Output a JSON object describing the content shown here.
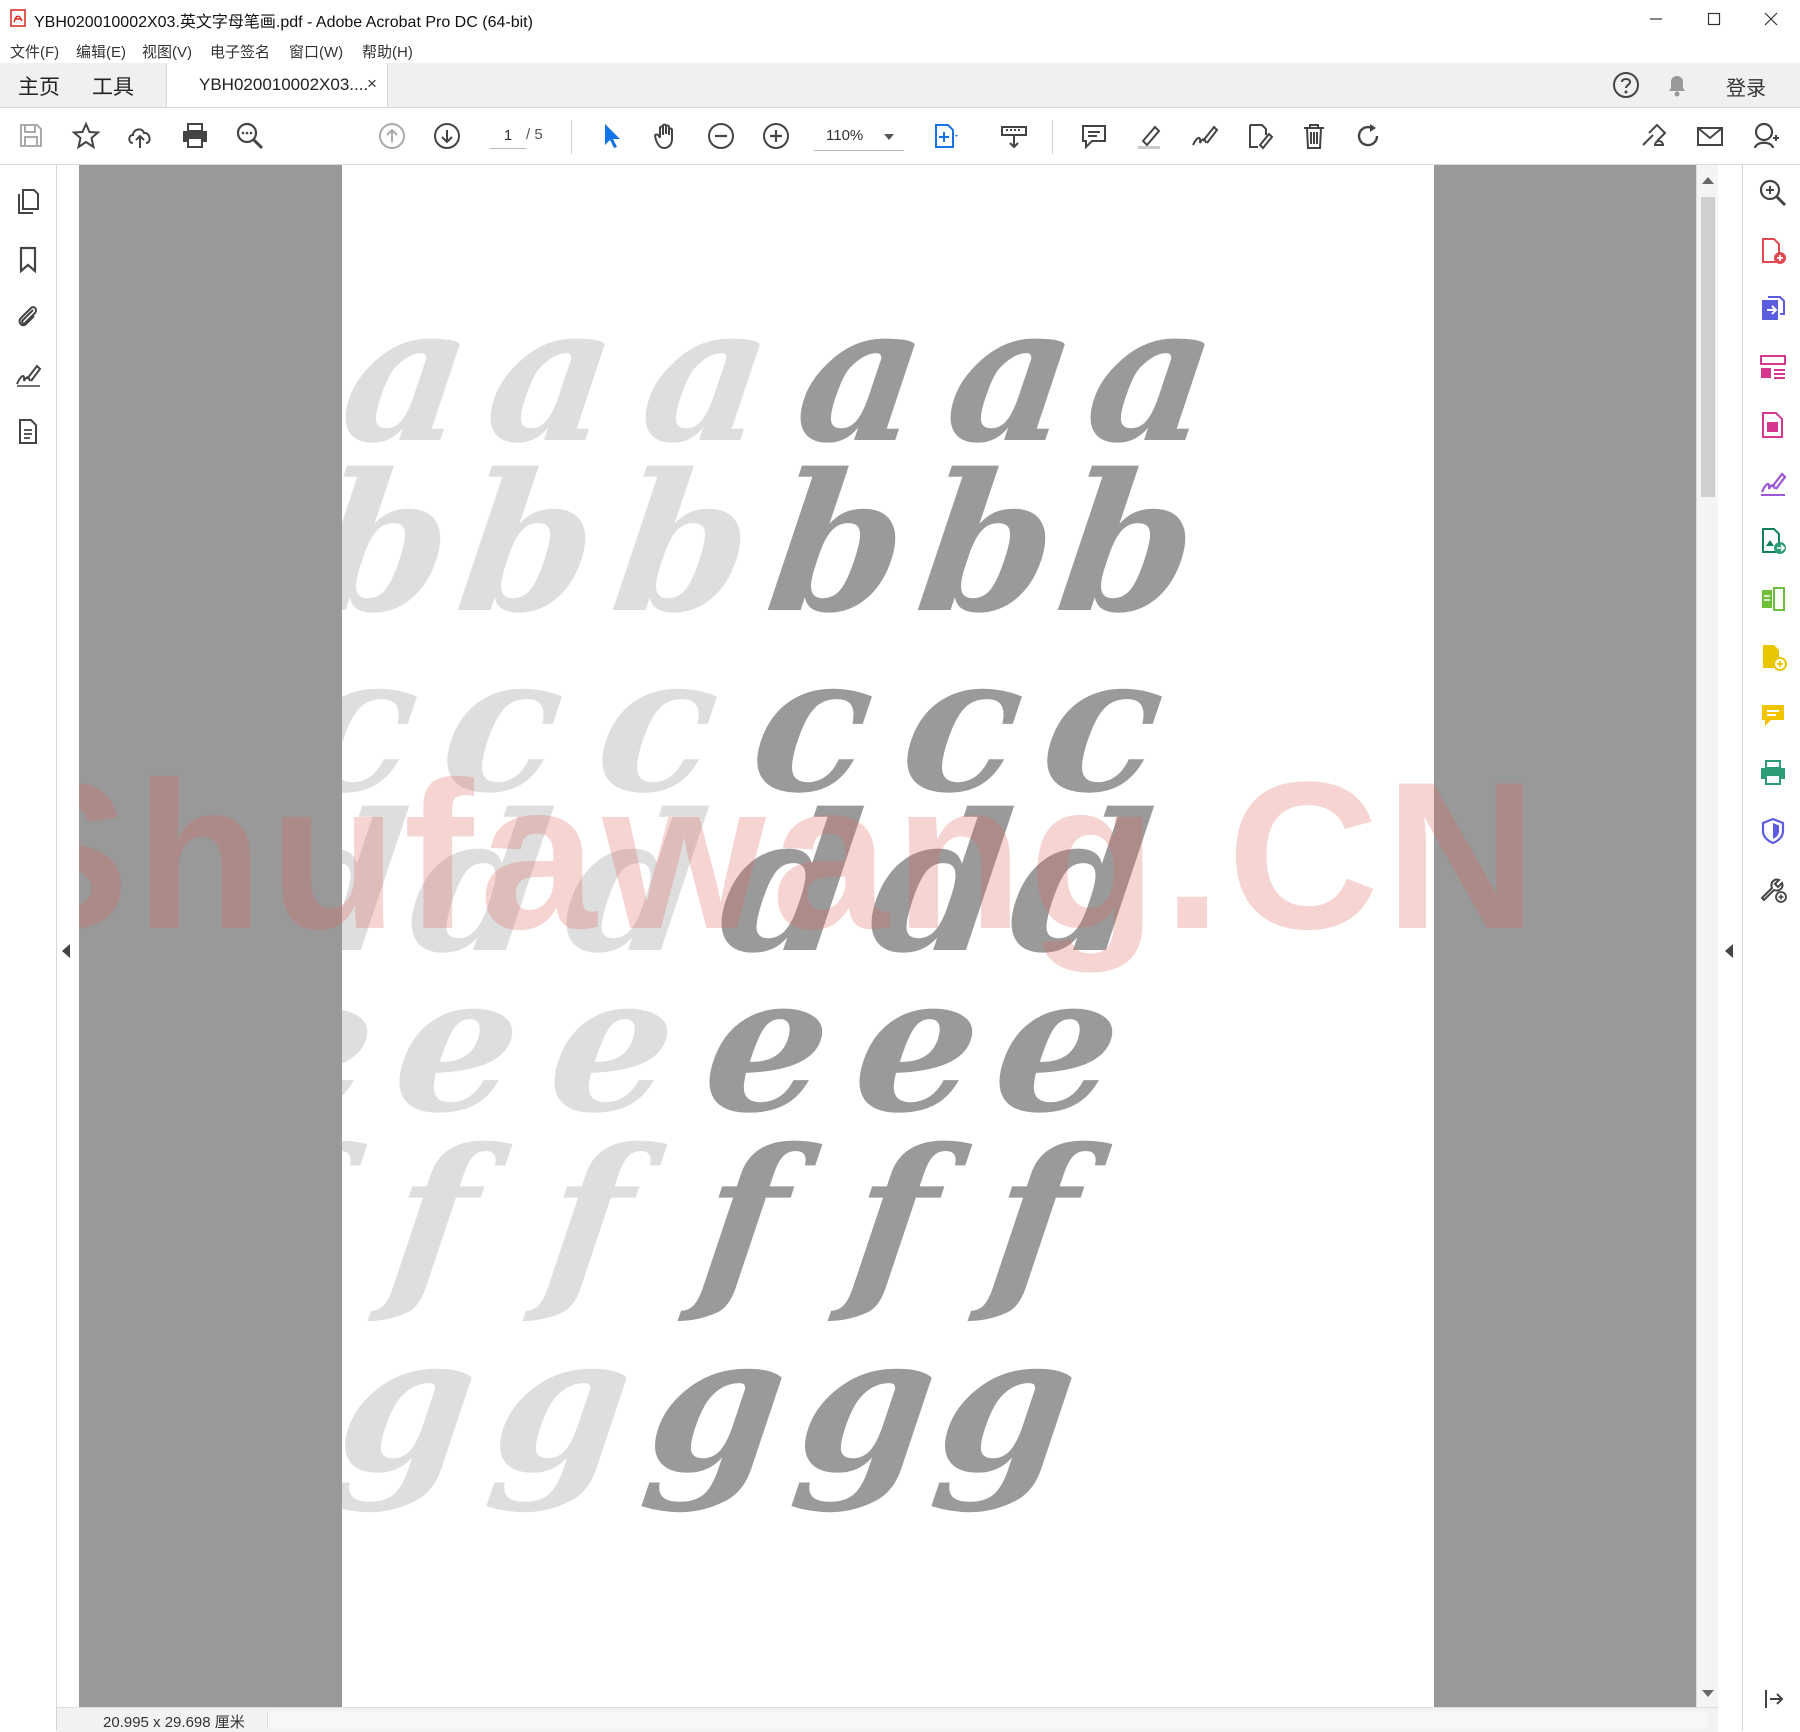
{
  "window": {
    "title": "YBH020010002X03.英文字母笔画.pdf - Adobe Acrobat Pro DC (64-bit)",
    "controls": [
      "minimize-icon",
      "maximize-icon",
      "close-icon"
    ]
  },
  "menu": {
    "items": [
      "文件(F)",
      "编辑(E)",
      "视图(V)",
      "电子签名",
      "窗口(W)",
      "帮助(H)"
    ]
  },
  "tabs": {
    "home": "主页",
    "tools": "工具",
    "document": "YBH020010002X03....",
    "close": "×",
    "signin": "登录"
  },
  "toolbar": {
    "page_current": "1",
    "page_total": "/ 5",
    "zoom": "110%",
    "icons": [
      "save-icon",
      "bookmark-star-icon",
      "upload-cloud-icon",
      "print-icon",
      "search-zoom-icon",
      "prev-page-icon",
      "next-page-icon",
      "select-arrow-icon",
      "hand-tool-icon",
      "zoom-out-icon",
      "zoom-in-icon",
      "fit-page-icon",
      "keyboard-icon",
      "comment-icon",
      "highlight-pen-icon",
      "sign-icon",
      "stamp-icon",
      "delete-icon",
      "rotate-icon",
      "share-link-icon",
      "email-icon",
      "add-user-icon"
    ]
  },
  "left_panel": {
    "icons": [
      "pages-icon",
      "bookmark-icon",
      "attachment-icon",
      "signature-icon",
      "document-icon"
    ]
  },
  "right_panel": {
    "icons": [
      "zoom-search-icon",
      "create-pdf-icon",
      "export-pdf-icon",
      "organize-pages-icon",
      "edit-pdf-icon",
      "fill-sign-icon",
      "export-image-icon",
      "compare-icon",
      "combine-icon",
      "comment-panel-icon",
      "print-production-icon",
      "protect-icon",
      "more-tools-icon"
    ]
  },
  "document": {
    "letters": [
      "a",
      "b",
      "c",
      "d",
      "e",
      "f",
      "g"
    ],
    "columns_light": 3,
    "columns_dark": 3,
    "watermark": "Shufawang.CN",
    "light_color": "#dedede",
    "dark_color": "#9a9a9a"
  },
  "status": {
    "dimensions": "20.995 x 29.698 厘米"
  },
  "colors": {
    "accent_blue": "#1473e6",
    "viewport_gray": "#999999"
  }
}
